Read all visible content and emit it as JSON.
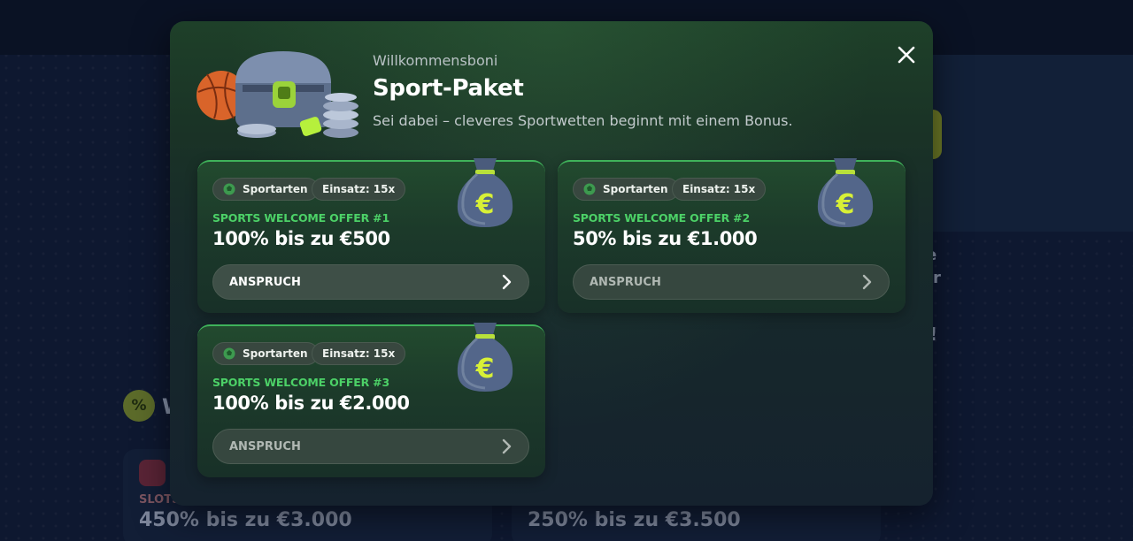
{
  "background": {
    "section_icon": "%",
    "section_fragment": "W",
    "right_fragments": [
      "e",
      "r",
      "!"
    ],
    "cards": [
      {
        "label": "SLOTS",
        "amount": "450% bis zu €3.000"
      },
      {
        "label": "",
        "amount": "250% bis zu €3.500"
      }
    ]
  },
  "modal": {
    "kicker": "Willkommensboni",
    "title": "Sport-Paket",
    "subtitle": "Sei dabei – cleveres Sportwetten beginnt mit einem Bonus.",
    "close_icon": "close-icon",
    "hero_icon": "treasure-chest-icon"
  },
  "offers": [
    {
      "sport_chip": "Sportarten",
      "stake_chip": "Einsatz: 15x",
      "label": "SPORTS WELCOME OFFER #1",
      "amount": "100% bis zu €500",
      "button": "ANSPRUCH"
    },
    {
      "sport_chip": "Sportarten",
      "stake_chip": "Einsatz: 15x",
      "label": "SPORTS WELCOME OFFER #2",
      "amount": "50% bis zu €1.000",
      "button": "ANSPRUCH"
    },
    {
      "sport_chip": "Sportarten",
      "stake_chip": "Einsatz: 15x",
      "label": "SPORTS WELCOME OFFER #3",
      "amount": "100% bis zu €2.000",
      "button": "ANSPRUCH"
    }
  ],
  "colors": {
    "accent_green": "#4cd167",
    "card_border": "#3fb25a",
    "euro_yellow": "#d8f036"
  }
}
